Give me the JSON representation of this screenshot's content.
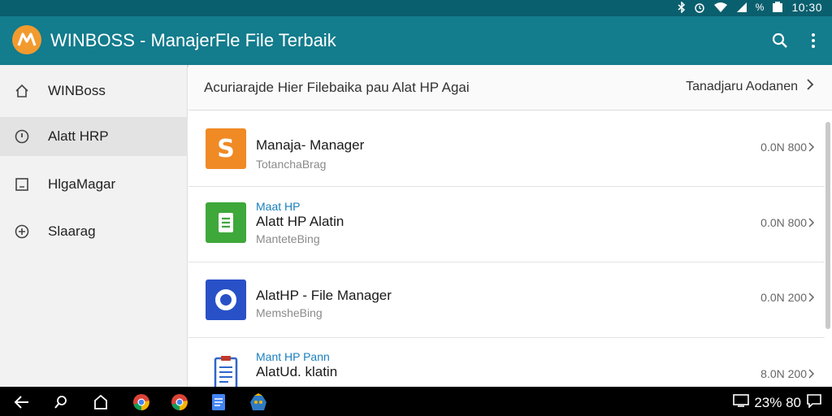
{
  "status_bar": {
    "time": "10:30",
    "percent_glyph": "%",
    "icons": [
      "bluetooth-icon",
      "alarm-icon",
      "wifi-icon",
      "signal-icon",
      "battery-icon"
    ]
  },
  "app_bar": {
    "title": "WINBOSS - ManajerFle File Terbaik",
    "logo_text": "M",
    "colors": {
      "bar": "#137c8d",
      "status": "#0a5f6e",
      "logo": "#f29a2e"
    },
    "icons": [
      "search-icon",
      "more-vert-icon"
    ]
  },
  "sidebar": {
    "items": [
      {
        "label": "WINBoss",
        "icon": "home-icon",
        "active": false
      },
      {
        "label": "Alatt HRP",
        "icon": "info-circle-icon",
        "active": true
      },
      {
        "label": "HlgaMagar",
        "icon": "square-icon",
        "active": false
      },
      {
        "label": "Slaarag",
        "icon": "add-circle-icon",
        "active": false
      }
    ]
  },
  "breadcrumb": {
    "text": "Acuriarajde Hier Filebaika pau Alat HP Agai",
    "action_label": "Tanadjaru Aodanen"
  },
  "files": [
    {
      "tag": "",
      "title": "Manaja- Manager",
      "subtitle": "TotanchaBrag",
      "size": "0.0N 800",
      "icon": "orange-s-app-icon",
      "icon_color": "#f08a24"
    },
    {
      "tag": "Maat HP",
      "title": "Alatt HP Alatin",
      "subtitle": "ManteteBing",
      "size": "0.0N 800",
      "icon": "green-document-icon",
      "icon_color": "#3fa83a"
    },
    {
      "tag": "",
      "title": "AlatHP - File Manager",
      "subtitle": "MemsheBing",
      "size": "0.0N 200",
      "icon": "blue-ring-app-icon",
      "icon_color": "#2851c7"
    },
    {
      "tag": "Mant HP Pann",
      "title": "AlatUd. klatin",
      "subtitle": "",
      "size": "8.0N 200",
      "icon": "clipboard-icon",
      "icon_color": "#2f66c9"
    }
  ],
  "nav_bar": {
    "right_text": "23% 80",
    "icons": [
      "back-icon",
      "search-icon",
      "home-icon",
      "chrome-icon",
      "chrome-icon",
      "docs-icon",
      "game-icon"
    ]
  }
}
